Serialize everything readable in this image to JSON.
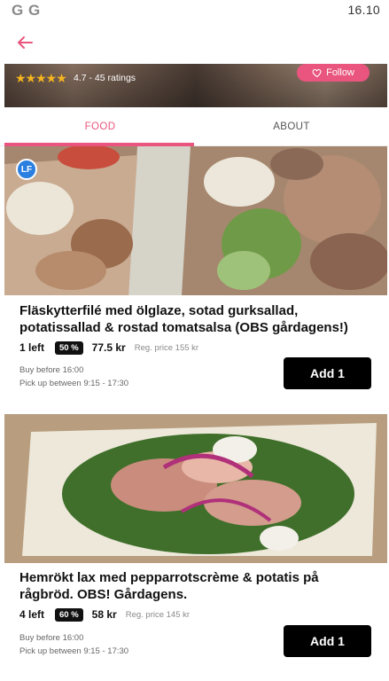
{
  "status_bar": {
    "left_icons": [
      "G",
      "G"
    ],
    "time": "16.10"
  },
  "app_bar": {
    "back_icon": "arrow-left-icon"
  },
  "store": {
    "stars": "★★★★★",
    "rating_text": "4.7 - 45 ratings",
    "follow_label": "Follow",
    "follow_icon": "heart-outline-icon"
  },
  "tabs": [
    {
      "label": "FOOD",
      "active": true
    },
    {
      "label": "ABOUT",
      "active": false
    }
  ],
  "colors": {
    "accent": "#e9557e",
    "button": "#000000",
    "badge_lf": "#2b7fe0"
  },
  "items": [
    {
      "badge": "LF",
      "title": "Fläskytterfilé med ölglaze, sotad gurksallad, potatissallad & rostad tomatsalsa (OBS gårdagens!)",
      "left": "1 left",
      "discount": "50 %",
      "price": "77.5 kr",
      "reg_price": "Reg. price 155 kr",
      "buy_before": "Buy before 16:00",
      "pickup": "Pick up between 9:15 - 17:30",
      "button_label": "Add 1"
    },
    {
      "title": "Hemrökt lax med pepparrotscrème & potatis på rågbröd. OBS! Gårdagens.",
      "left": "4 left",
      "discount": "60 %",
      "price": "58 kr",
      "reg_price": "Reg. price 145 kr",
      "buy_before": "Buy before 16:00",
      "pickup": "Pick up between 9:15 - 17:30",
      "button_label": "Add 1"
    }
  ]
}
